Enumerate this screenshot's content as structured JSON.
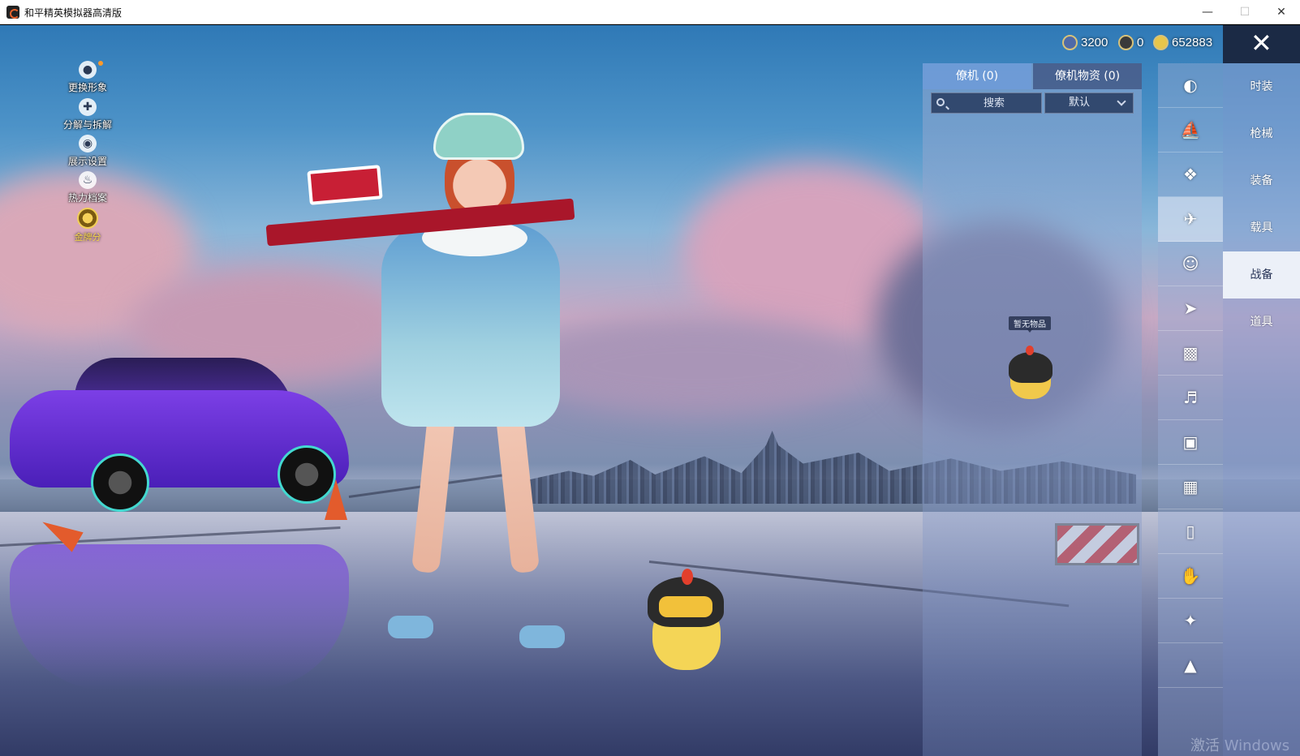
{
  "window": {
    "title": "和平精英模拟器高清版"
  },
  "left_menu": {
    "items": [
      {
        "label": "更换形象"
      },
      {
        "label": "分解与拆解"
      },
      {
        "label": "展示设置"
      },
      {
        "label": "热力档案"
      }
    ],
    "rank": {
      "label": "金牌分"
    }
  },
  "currency": {
    "coins": "3200",
    "tokens": "0",
    "gold": "652883"
  },
  "pet_panel": {
    "tabs": [
      {
        "label": "僚机 (0)"
      },
      {
        "label": "僚机物资 (0)"
      }
    ],
    "search": {
      "placeholder": "搜索"
    },
    "sort": {
      "selected": "默认"
    },
    "tooltip": "暂无物品"
  },
  "icon_column": {
    "icons": [
      "helmet-icon",
      "boat-icon",
      "drone-icon",
      "plane-icon",
      "emote-icon",
      "parachute-icon",
      "robot-icon",
      "speaker-icon",
      "chat-icon",
      "photo-icon",
      "spray-icon",
      "gesture-icon",
      "wand-icon",
      "hat-icon"
    ]
  },
  "categories": {
    "items": [
      {
        "label": "时装"
      },
      {
        "label": "枪械"
      },
      {
        "label": "装备"
      },
      {
        "label": "载具"
      },
      {
        "label": "战备"
      },
      {
        "label": "道具"
      }
    ]
  },
  "watermark": "激活 Windows",
  "colors": {
    "accent_tab": "#6e9bd7",
    "active_category_bg": "#f0f3fa"
  }
}
